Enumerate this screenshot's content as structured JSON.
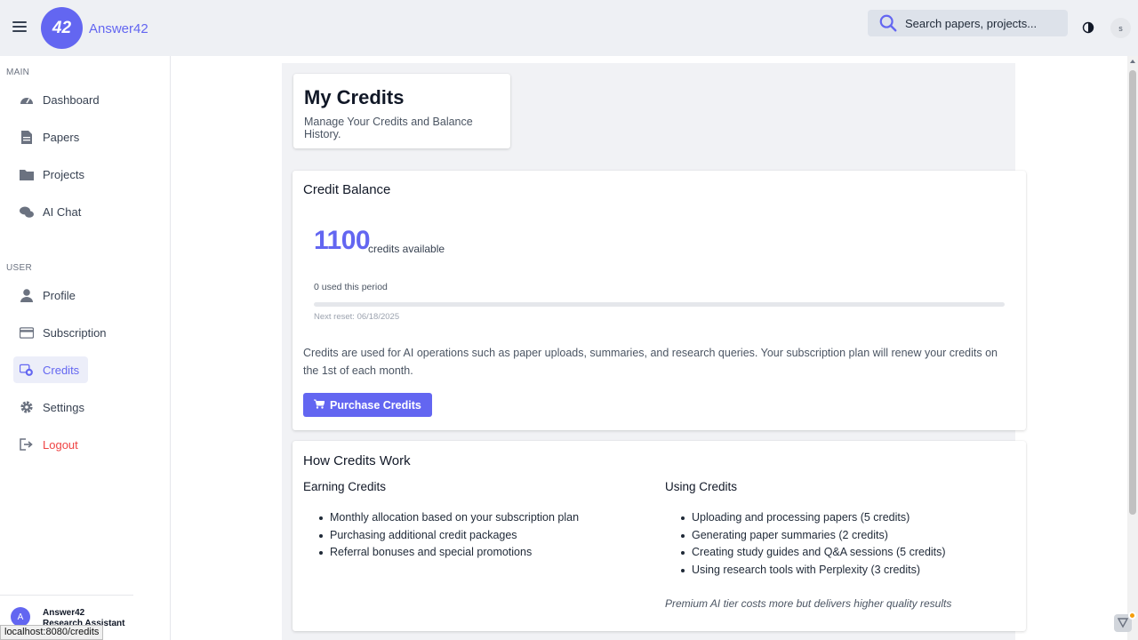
{
  "header": {
    "brand": "Answer42",
    "logo_text": "42",
    "search_placeholder": "Search papers, projects...",
    "avatar_initial": "s"
  },
  "sidebar": {
    "main_label": "MAIN",
    "main_items": [
      {
        "label": "Dashboard",
        "icon": "dashboard-icon"
      },
      {
        "label": "Papers",
        "icon": "document-icon"
      },
      {
        "label": "Projects",
        "icon": "folder-icon"
      },
      {
        "label": "AI Chat",
        "icon": "chat-icon"
      }
    ],
    "user_label": "USER",
    "user_items": [
      {
        "label": "Profile",
        "icon": "user-icon"
      },
      {
        "label": "Subscription",
        "icon": "credit-card-icon"
      },
      {
        "label": "Credits",
        "icon": "coins-icon",
        "active": true
      },
      {
        "label": "Settings",
        "icon": "gear-icon"
      },
      {
        "label": "Logout",
        "icon": "logout-icon"
      }
    ],
    "user": {
      "initial": "A",
      "name": "Answer42",
      "role": "Research Assistant"
    }
  },
  "status_url": "localhost:8080/credits",
  "page": {
    "title": "My Credits",
    "subtitle": "Manage Your Credits and Balance History."
  },
  "balance": {
    "title": "Credit Balance",
    "amount": "1100",
    "unit": "credits available",
    "used": "0 used this period",
    "used_fraction": 0,
    "next_reset": "Next reset: 06/18/2025",
    "description": "Credits are used for AI operations such as paper uploads, summaries, and research queries. Your subscription plan will renew your credits on the 1st of each month.",
    "button": "Purchase Credits"
  },
  "how": {
    "title": "How Credits Work",
    "earning_title": "Earning Credits",
    "earning": [
      "Monthly allocation based on your subscription plan",
      "Purchasing additional credit packages",
      "Referral bonuses and special promotions"
    ],
    "using_title": "Using Credits",
    "using": [
      "Uploading and processing papers (5 credits)",
      "Generating paper summaries (2 credits)",
      "Creating study guides and Q&A sessions (5 credits)",
      "Using research tools with Perplexity (3 credits)"
    ],
    "note": "Premium AI tier costs more but delivers higher quality results"
  },
  "colors": {
    "accent": "#6366f1",
    "logout": "#ef4444"
  }
}
